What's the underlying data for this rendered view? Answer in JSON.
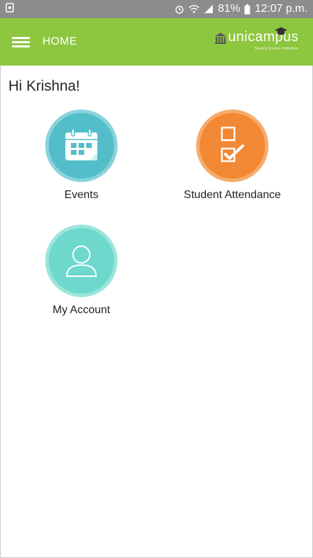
{
  "status_bar": {
    "battery": "81%",
    "time": "12:07 p.m.",
    "icons": [
      "notification-icon",
      "alarm-icon",
      "wifi-icon",
      "signal-icon",
      "battery-icon"
    ]
  },
  "app_bar": {
    "title": "HOME",
    "logo_text": "unicampus",
    "logo_tagline": "Shaping Smarter Institutions"
  },
  "greeting": {
    "hi": "Hi",
    "name": "Krishna!"
  },
  "tiles": [
    {
      "label": "Events",
      "icon": "calendar-icon",
      "color": "#53bec9"
    },
    {
      "label": "Student Attendance",
      "icon": "attendance-checkbox-icon",
      "color": "#f28834"
    },
    {
      "label": "My Account",
      "icon": "user-icon",
      "color": "#6ed8cc"
    }
  ],
  "colors": {
    "app_bar": "#8dc63f",
    "status_bar": "#8c8c8c"
  }
}
